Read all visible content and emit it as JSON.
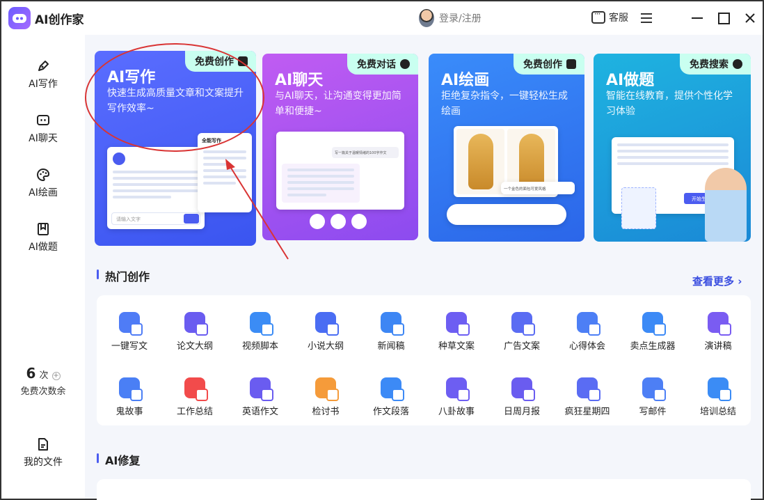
{
  "app": {
    "title": "AI创作家"
  },
  "header": {
    "login": "登录/注册",
    "service": "客服"
  },
  "sidebar": {
    "items": [
      {
        "label": "AI写作",
        "icon": "pen-icon"
      },
      {
        "label": "AI聊天",
        "icon": "chat-icon"
      },
      {
        "label": "AI绘画",
        "icon": "palette-icon"
      },
      {
        "label": "AI做题",
        "icon": "bookmark-icon"
      }
    ],
    "quota_value": "6",
    "quota_unit": "次",
    "quota_label": "免费次数余",
    "my_files": "我的文件"
  },
  "cards": [
    {
      "title": "AI写作",
      "desc": "快速生成高质量文章和文案提升写作效率~",
      "badge": "免费创作"
    },
    {
      "title": "AI聊天",
      "desc": "与AI聊天，让沟通变得更加简单和便捷~",
      "badge": "免费对话"
    },
    {
      "title": "AI绘画",
      "desc": "拒绝复杂指令，一键轻松生成绘画",
      "badge": "免费创作"
    },
    {
      "title": "AI做题",
      "desc": "智能在线教育，提供个性化学习体验",
      "badge": "免费搜索"
    }
  ],
  "card_mock": {
    "w1_mode": "全能写作",
    "w1_input": "请输入文字",
    "w2_prompt": "写一篇关于温暖情绪的100字作文",
    "w3_prompt": "一个金色的面包可爱风格",
    "w4_btn": "开始生成"
  },
  "hot": {
    "title": "热门创作",
    "more": "查看更多",
    "tools": [
      {
        "label": "一键写文",
        "color": "#4f7cf6"
      },
      {
        "label": "论文大纲",
        "color": "#6a5cf0"
      },
      {
        "label": "视频脚本",
        "color": "#3b8cf5"
      },
      {
        "label": "小说大纲",
        "color": "#4a6df3"
      },
      {
        "label": "新闻稿",
        "color": "#3d86f4"
      },
      {
        "label": "种草文案",
        "color": "#6d5ef2"
      },
      {
        "label": "广告文案",
        "color": "#5a6cf3"
      },
      {
        "label": "心得体会",
        "color": "#4d7ff5"
      },
      {
        "label": "卖点生成器",
        "color": "#3c8af6"
      },
      {
        "label": "演讲稿",
        "color": "#7a5cf2"
      },
      {
        "label": "鬼故事",
        "color": "#4a7ff5"
      },
      {
        "label": "工作总结",
        "color": "#f24b4b"
      },
      {
        "label": "英语作文",
        "color": "#6a5cf0"
      },
      {
        "label": "检讨书",
        "color": "#f59b3a"
      },
      {
        "label": "作文段落",
        "color": "#3c8af6"
      },
      {
        "label": "八卦故事",
        "color": "#6d5ef2"
      },
      {
        "label": "日周月报",
        "color": "#6a5cf0"
      },
      {
        "label": "疯狂星期四",
        "color": "#5a6cf3"
      },
      {
        "label": "写邮件",
        "color": "#4d7ff5"
      },
      {
        "label": "培训总结",
        "color": "#3b8cf5"
      }
    ]
  },
  "repair": {
    "title": "AI修复"
  }
}
